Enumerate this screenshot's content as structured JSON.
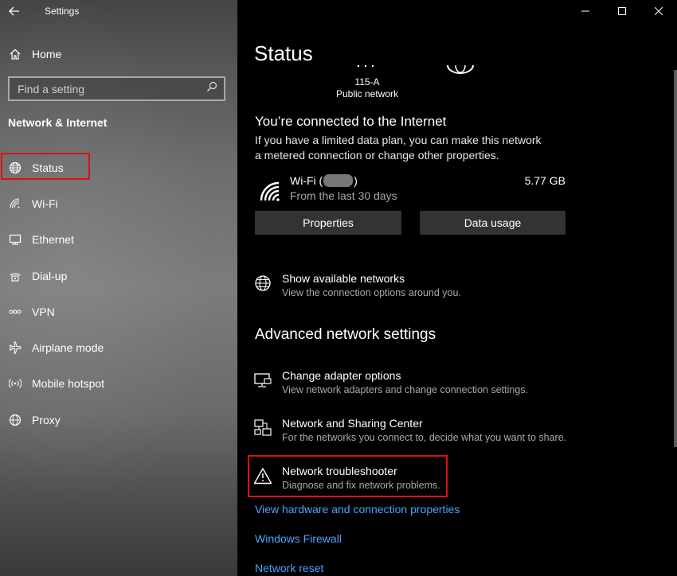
{
  "window": {
    "app_title": "Settings",
    "controls": [
      "minimize",
      "maximize",
      "close"
    ]
  },
  "sidebar": {
    "home_label": "Home",
    "search_placeholder": "Find a setting",
    "section_title": "Network & Internet",
    "items": [
      {
        "label": "Status",
        "icon": "globe-icon",
        "selected": true
      },
      {
        "label": "Wi-Fi",
        "icon": "wifi-icon",
        "selected": false
      },
      {
        "label": "Ethernet",
        "icon": "ethernet-icon",
        "selected": false
      },
      {
        "label": "Dial-up",
        "icon": "dialup-icon",
        "selected": false
      },
      {
        "label": "VPN",
        "icon": "vpn-icon",
        "selected": false
      },
      {
        "label": "Airplane mode",
        "icon": "airplane-icon",
        "selected": false
      },
      {
        "label": "Mobile hotspot",
        "icon": "hotspot-icon",
        "selected": false
      },
      {
        "label": "Proxy",
        "icon": "proxy-globe-icon",
        "selected": false
      }
    ]
  },
  "main": {
    "page_title": "Status",
    "network": {
      "name": "115-A",
      "type": "Public network"
    },
    "connection": {
      "title": "You’re connected to the Internet",
      "description": "If you have a limited data plan, you can make this network a metered connection or change other properties."
    },
    "wifi_usage": {
      "name_prefix": "Wi-Fi (",
      "name_suffix": ")",
      "period": "From the last 30 days",
      "usage": "5.77 GB"
    },
    "buttons": {
      "properties": "Properties",
      "data_usage": "Data usage"
    },
    "show_networks": {
      "title": "Show available networks",
      "description": "View the connection options around you."
    },
    "advanced_title": "Advanced network settings",
    "advanced_items": [
      {
        "title": "Change adapter options",
        "description": "View network adapters and change connection settings.",
        "icon": "adapter-icon"
      },
      {
        "title": "Network and Sharing Center",
        "description": "For the networks you connect to, decide what you want to share.",
        "icon": "sharing-center-icon"
      },
      {
        "title": "Network troubleshooter",
        "description": "Diagnose and fix network problems.",
        "icon": "warning-icon",
        "highlighted": true
      }
    ],
    "links": [
      "View hardware and connection properties",
      "Windows Firewall",
      "Network reset"
    ],
    "colors": {
      "highlight": "#e01010",
      "link": "#4da2ff",
      "button_bg": "#333333"
    }
  }
}
